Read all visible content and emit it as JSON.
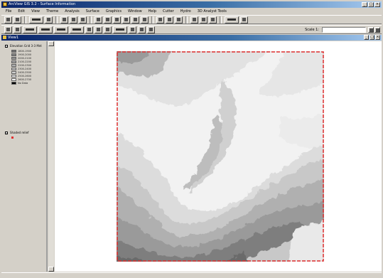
{
  "window": {
    "title": "ArcView GIS 3.2 - Surface Information",
    "controls": [
      "_",
      "□",
      "×"
    ]
  },
  "menubar": [
    "File",
    "Edit",
    "View",
    "Theme",
    "Analysis",
    "Surface",
    "Graphics",
    "Window",
    "Help",
    "Cutter",
    "Hydro",
    "3D Analyst Tools"
  ],
  "toolbar": {
    "scale_label": "Scale 1:",
    "scale_value": ""
  },
  "document": {
    "title": "View1",
    "controls": [
      "_",
      "□",
      "×"
    ]
  },
  "toc": {
    "theme1": {
      "name": "Elevation Grid 3-3 Mnt",
      "visible": true,
      "legend": [
        {
          "label": "1800-1900",
          "color": "#707070"
        },
        {
          "label": "1900-2000",
          "color": "#808080"
        },
        {
          "label": "2000-2100",
          "color": "#909090"
        },
        {
          "label": "2100-2200",
          "color": "#a0a0a0"
        },
        {
          "label": "2200-2300",
          "color": "#b0b0b0"
        },
        {
          "label": "2300-2400",
          "color": "#c0c0c0"
        },
        {
          "label": "2400-2500",
          "color": "#d0d0d0"
        },
        {
          "label": "2500-2600",
          "color": "#e0e0e0"
        },
        {
          "label": "2600-2700",
          "color": "#f0f0f0"
        },
        {
          "label": "No Data",
          "color": "#000000"
        }
      ]
    },
    "theme2": {
      "name": "Shaded relief",
      "visible": true
    }
  },
  "colors": {
    "title_bar": "#0a246a",
    "frame_red": "#e03030",
    "face": "#d4d0c8"
  }
}
